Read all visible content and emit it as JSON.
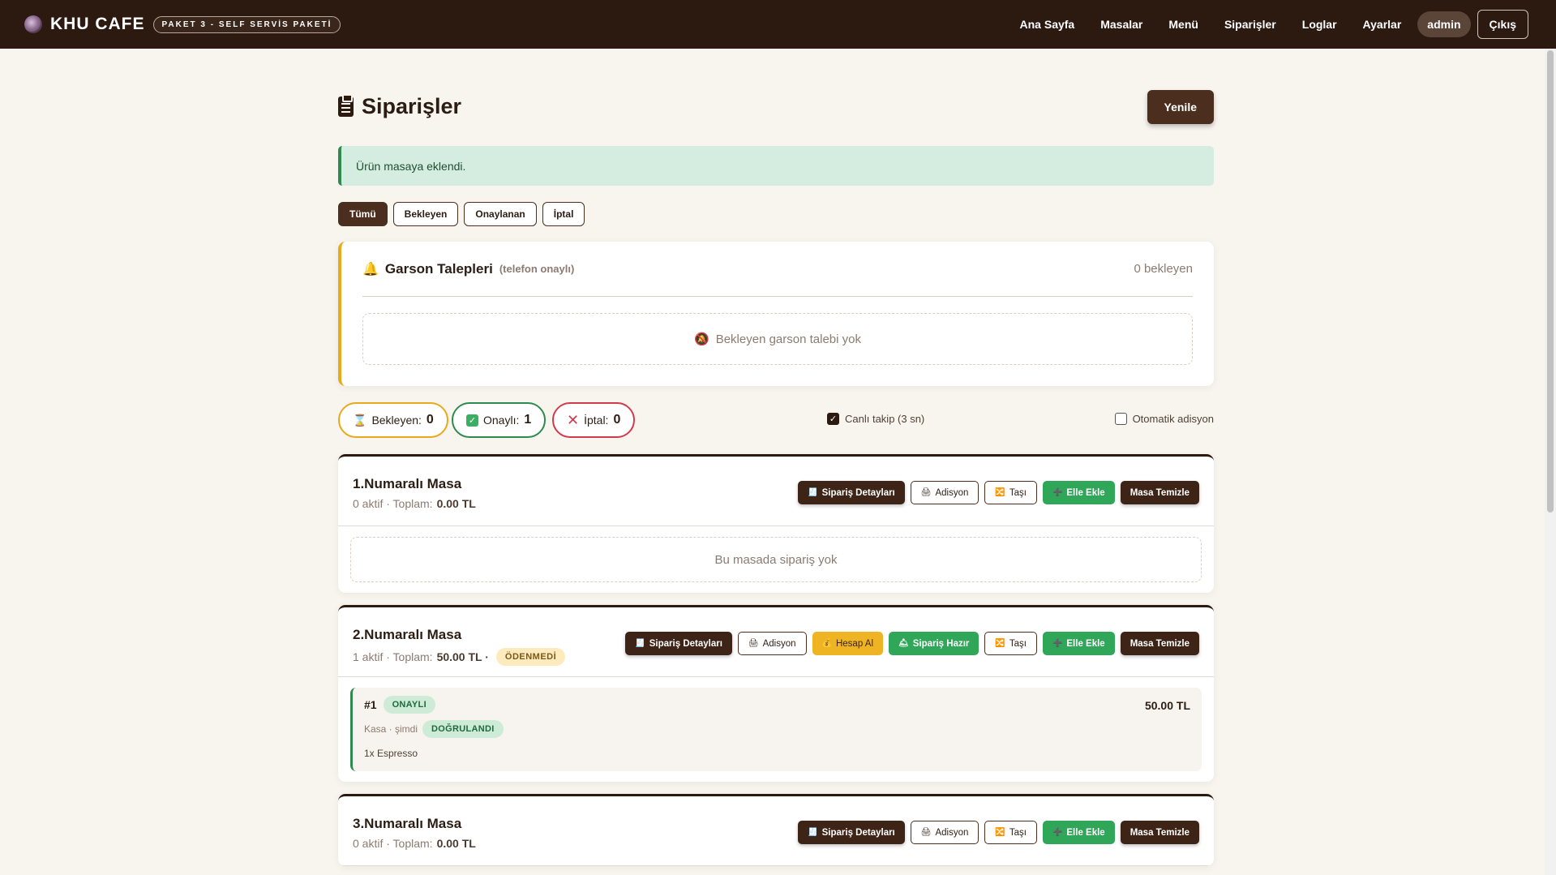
{
  "nav": {
    "brand_name": "KHU CAFE",
    "brand_badge": "PAKET 3 - SELF SERVİS PAKETİ",
    "links": [
      "Ana Sayfa",
      "Masalar",
      "Menü",
      "Siparişler",
      "Loglar",
      "Ayarlar"
    ],
    "user": "admin",
    "logout": "Çıkış"
  },
  "page": {
    "title": "Siparişler",
    "refresh": "Yenile",
    "alert": "Ürün masaya eklendi."
  },
  "filters": [
    "Tümü",
    "Bekleyen",
    "Onaylanan",
    "İptal"
  ],
  "garson": {
    "title": "Garson Talepleri",
    "subtitle": "(telefon onaylı)",
    "count": "0 bekleyen",
    "empty": "Bekleyen garson talebi yok"
  },
  "stats": {
    "wait_label": "Bekleyen:",
    "wait_value": "0",
    "ok_label": "Onaylı:",
    "ok_value": "1",
    "cancel_label": "İptal:",
    "cancel_value": "0",
    "live_track": "Canlı takip (3 sn)",
    "auto_bill": "Otomatik adisyon"
  },
  "actions": {
    "details": "Sipariş Detayları",
    "bill": "Adisyon",
    "pay": "Hesap Al",
    "ready": "Sipariş Hazır",
    "move": "Taşı",
    "add": "Elle Ekle",
    "clear": "Masa Temizle"
  },
  "tables": [
    {
      "title": "1.Numaralı Masa",
      "active": "0 aktif · Toplam:",
      "total": "0.00 TL",
      "empty": "Bu masada sipariş yok"
    },
    {
      "title": "2.Numaralı Masa",
      "active": "1 aktif · Toplam:",
      "total": "50.00 TL ·",
      "status": "ÖDENMEDİ",
      "order": {
        "num": "#1",
        "status": "ONAYLI",
        "price": "50.00 TL",
        "meta": "Kasa · şimdi",
        "verified": "DOĞRULANDI",
        "items": "1x Espresso"
      }
    },
    {
      "title": "3.Numaralı Masa",
      "active": "0 aktif · Toplam:",
      "total": "0.00 TL"
    }
  ],
  "colors": {
    "nav_bg": "#2c1a10",
    "accent_brown": "#4b2e1e",
    "success": "#2fa658",
    "warning": "#efb424",
    "danger": "#d23a4c"
  }
}
